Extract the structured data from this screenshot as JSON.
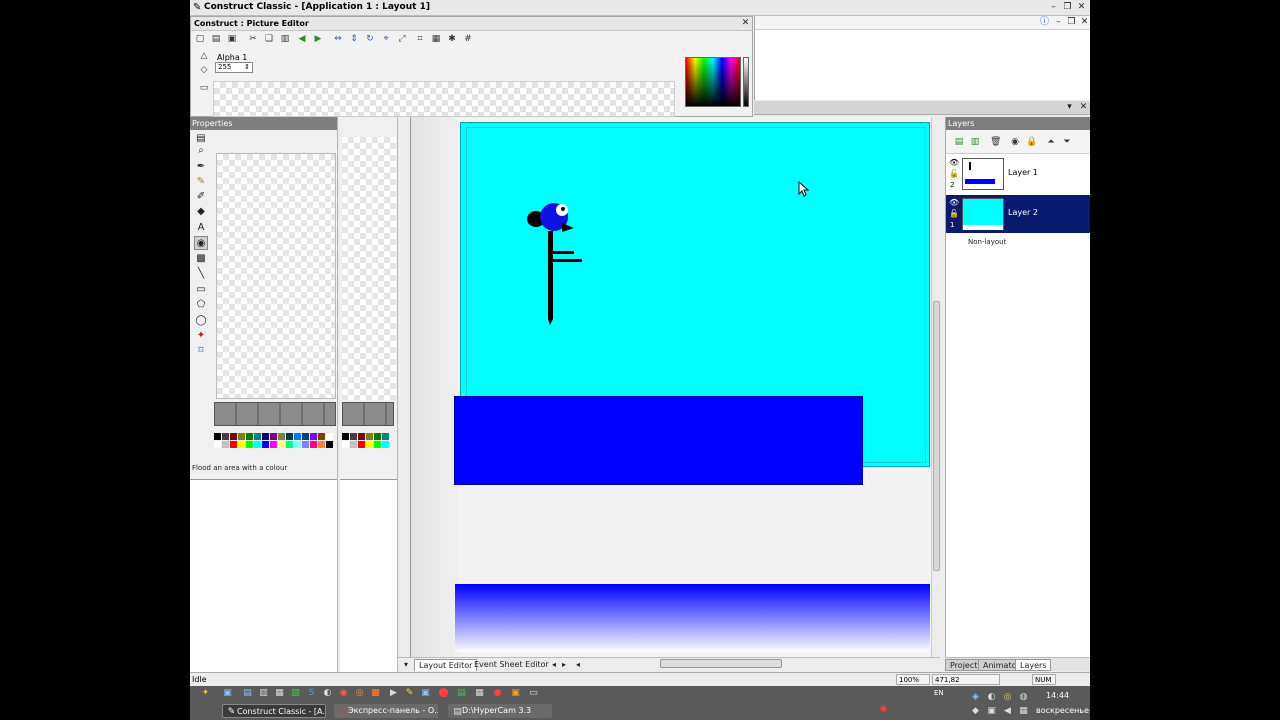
{
  "app": {
    "title": "Construct Classic - [Application 1 : Layout 1]",
    "logo_icon": "construct-logo-icon"
  },
  "picture_editor": {
    "title": "Construct : Picture Editor",
    "alpha_label": "Alpha 1",
    "alpha_value": "255"
  },
  "properties": {
    "title": "Properties",
    "hint": "Flood an area with a colour"
  },
  "layout_editor": {
    "tabs": [
      "Layout Editor",
      "Event Sheet Editor"
    ],
    "colors": {
      "sky": "#00ffff",
      "ground": "#0000ff"
    }
  },
  "layers": {
    "title": "Layers",
    "items": [
      {
        "name": "Layer 1",
        "index": "2"
      },
      {
        "name": "Layer 2",
        "index": "1",
        "selected": true
      }
    ],
    "non_layout": "Non-layout",
    "bottom_tabs": [
      "Project",
      "Animator",
      "Layers"
    ]
  },
  "status": {
    "state": "Idle",
    "zoom": "100%",
    "coords": "471,82",
    "numlock": "NUM"
  },
  "taskbar": {
    "language": "EN",
    "time": "14:44",
    "day": "воскресенье",
    "tasks": [
      "Construct Classic - [A...",
      "Экспресс-панель - О...",
      "D:\\HyperCam 3.3"
    ]
  }
}
